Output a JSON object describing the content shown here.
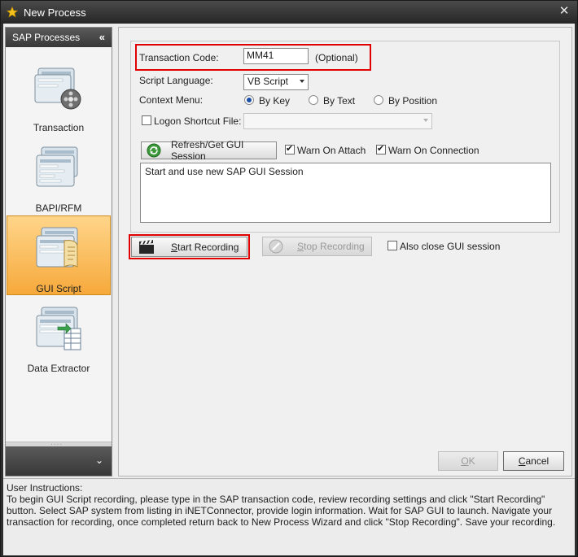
{
  "window": {
    "title": "New Process",
    "close_icon": "close-icon"
  },
  "nav": {
    "header": "SAP Processes",
    "collapse_glyph": "«",
    "footer_glyph": "⌄",
    "grip": "....",
    "items": [
      {
        "label": "Transaction",
        "icon": "transaction-icon",
        "selected": false
      },
      {
        "label": "BAPI/RFM",
        "icon": "bapi-icon",
        "selected": false
      },
      {
        "label": "GUI Script",
        "icon": "gui-script-icon",
        "selected": true
      },
      {
        "label": "Data Extractor",
        "icon": "data-extractor-icon",
        "selected": false
      }
    ]
  },
  "form": {
    "transaction_code_label": "Transaction Code:",
    "transaction_code_value": "MM41",
    "optional_text": "(Optional)",
    "script_language_label": "Script Language:",
    "script_language_value": "VB Script",
    "context_menu_label": "Context Menu:",
    "context_menu_options": [
      "By Key",
      "By Text",
      "By Position"
    ],
    "context_menu_selected": "By Key",
    "logon_shortcut_label": "Logon Shortcut File:",
    "logon_shortcut_checked": false,
    "refresh_button": "Refresh/Get GUI Session",
    "warn_on_attach": "Warn On Attach",
    "warn_on_attach_checked": true,
    "warn_on_connection": "Warn On Connection",
    "warn_on_connection_checked": true,
    "session_text": "Start and use new SAP GUI Session"
  },
  "actions": {
    "start_recording_prefix": "S",
    "start_recording_rest": "tart Recording",
    "stop_recording_prefix": "S",
    "stop_recording_rest": "top Recording",
    "also_close_label": "Also close GUI session",
    "also_close_checked": false,
    "ok_prefix": "O",
    "ok_rest": "K",
    "cancel_prefix": "C",
    "cancel_rest": "ancel"
  },
  "instructions": {
    "heading": "User Instructions:",
    "body": " To begin GUI Script recording, please type in the SAP transaction code, review recording settings and click \"Start Recording\" button. Select SAP system from listing in iNETConnector, provide login information. Wait for SAP GUI to launch. Navigate your transaction for recording, once completed return back to New Process Wizard and click \"Stop Recording\". Save your recording."
  },
  "colors": {
    "highlight": "#e00000",
    "selected_nav": "#f6a93b",
    "title_bar": "#2e2e2e"
  }
}
